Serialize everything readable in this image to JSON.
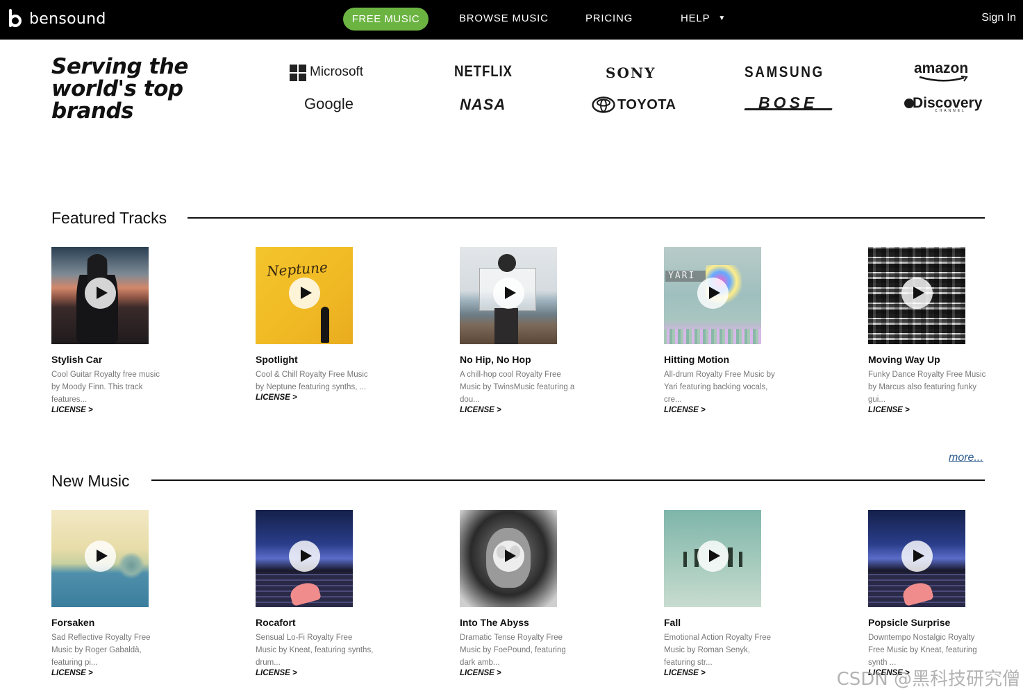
{
  "nav": {
    "logo": "bensound",
    "free_music": "FREE MUSIC",
    "browse_music": "BROWSE MUSIC",
    "pricing": "PRICING",
    "help": "HELP",
    "sign_in": "Sign In"
  },
  "brands": {
    "title": "Serving the world's top brands",
    "logos": [
      "Microsoft",
      "NETFLIX",
      "SONY",
      "SAMSUNG",
      "amazon",
      "Google",
      "NASA",
      "TOYOTA",
      "BOSE",
      "Discovery",
      "CHANNEL"
    ]
  },
  "featured": {
    "title": "Featured Tracks",
    "more": "more...",
    "tracks": [
      {
        "title": "Stylish Car",
        "desc": "Cool Guitar Royalty free music by Moody Finn. This track features...",
        "license": "LICENSE >"
      },
      {
        "title": "Spotlight",
        "desc": "Cool & Chill Royalty Free Music by Neptune featuring synths, ...",
        "license": "LICENSE >",
        "cover_text": "Neptune"
      },
      {
        "title": "No Hip, No Hop",
        "desc": "A chill-hop cool Royalty Free Music by TwinsMusic featuring a dou...",
        "license": "LICENSE >"
      },
      {
        "title": "Hitting Motion",
        "desc": "All-drum Royalty Free Music by Yari featuring backing vocals, cre...",
        "license": "LICENSE >",
        "cover_text": "YARI"
      },
      {
        "title": "Moving Way Up",
        "desc": "Funky Dance Royalty Free Music by Marcus also featuring funky gui...",
        "license": "LICENSE >"
      }
    ]
  },
  "new_music": {
    "title": "New Music",
    "tracks": [
      {
        "title": "Forsaken",
        "desc": "Sad Reflective Royalty Free Music by Roger Gabaldà, featuring pi...",
        "license": "LICENSE >"
      },
      {
        "title": "Rocafort",
        "desc": "Sensual Lo-Fi Royalty Free Music by Kneat, featuring synths, drum...",
        "license": "LICENSE >"
      },
      {
        "title": "Into The Abyss",
        "desc": "Dramatic Tense Royalty Free Music by FoePound, featuring dark amb...",
        "license": "LICENSE >"
      },
      {
        "title": "Fall",
        "desc": "Emotional Action Royalty Free Music by Roman Senyk, featuring str...",
        "license": "LICENSE >"
      },
      {
        "title": "Popsicle Surprise",
        "desc": "Downtempo Nostalgic Royalty Free Music by Kneat, featuring synth ...",
        "license": "LICENSE >"
      }
    ]
  },
  "watermark": "CSDN @黑科技研究僧",
  "colors": {
    "nav_bg": "#000000",
    "accent_green": "#6cb442",
    "more_link": "#2e5d8e"
  }
}
